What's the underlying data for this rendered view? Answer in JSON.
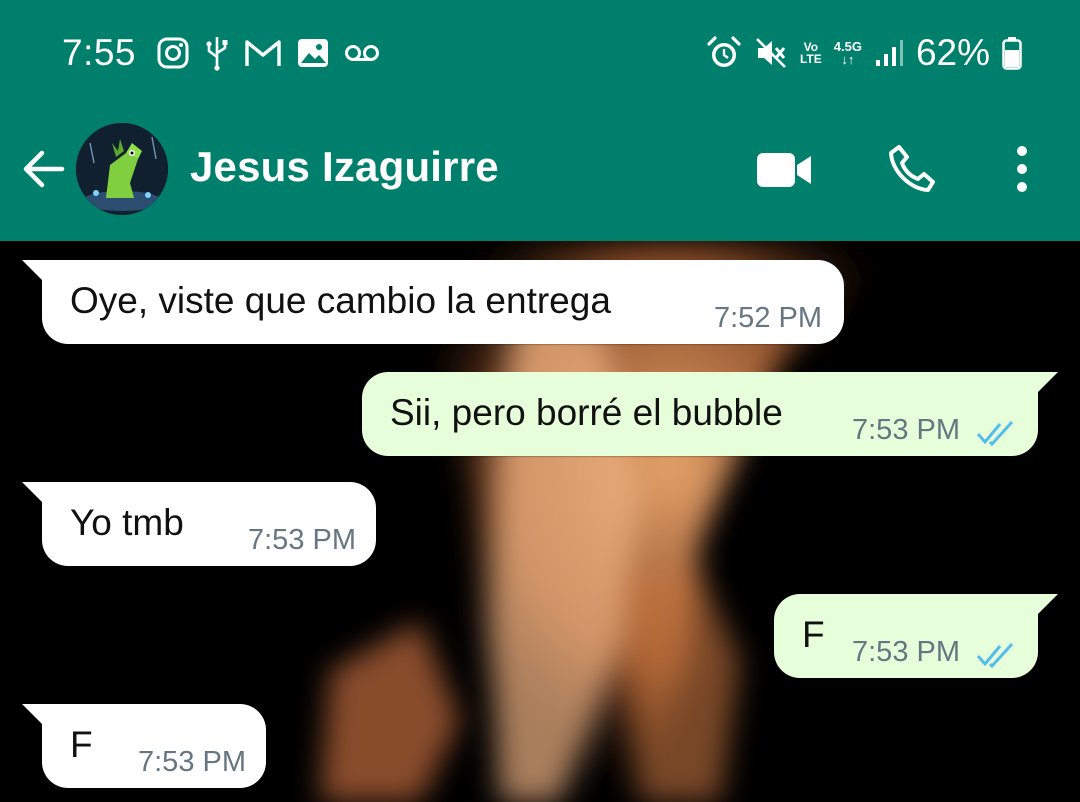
{
  "status_bar": {
    "time": "7:55",
    "volte": [
      "Vo",
      "LTE"
    ],
    "network": "4.5G",
    "battery": "62%"
  },
  "header": {
    "contact_name": "Jesus Izaguirre"
  },
  "messages": [
    {
      "direction": "in",
      "text": "Oye, viste que cambio la entrega",
      "time": "7:52 PM"
    },
    {
      "direction": "out",
      "text": "Sii, pero borré el bubble",
      "time": "7:53 PM",
      "status": "read"
    },
    {
      "direction": "in",
      "text": "Yo tmb",
      "time": "7:53 PM"
    },
    {
      "direction": "out",
      "text": "F",
      "time": "7:53 PM",
      "status": "read"
    },
    {
      "direction": "in",
      "text": "F",
      "time": "7:53 PM"
    }
  ],
  "colors": {
    "header": "#00806c",
    "incoming_bubble": "#ffffff",
    "outgoing_bubble": "#e6ffda",
    "read_ticks": "#53bdeb",
    "timestamp": "#667781"
  },
  "icons": [
    "instagram-icon",
    "usb-icon",
    "gmail-icon",
    "gallery-icon",
    "voicemail-icon",
    "alarm-icon",
    "mute-icon",
    "signal-icon",
    "battery-icon",
    "back-arrow-icon",
    "video-call-icon",
    "phone-icon",
    "more-options-icon"
  ]
}
